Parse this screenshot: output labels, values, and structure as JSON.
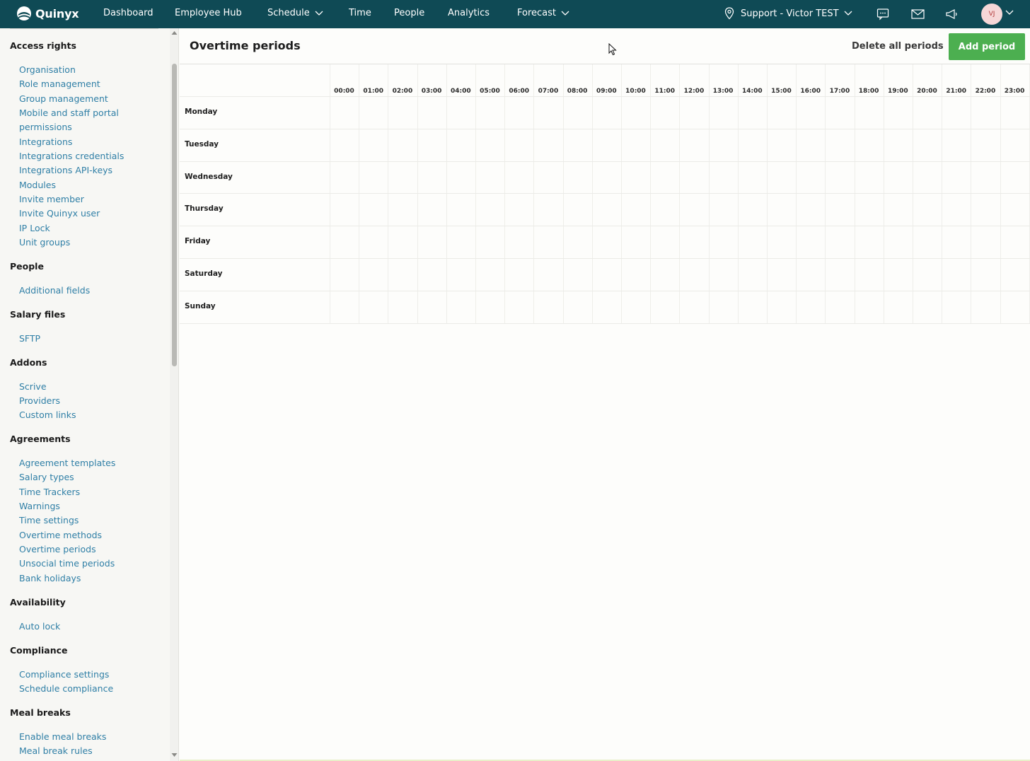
{
  "topnav": {
    "brand": "Quinyx",
    "items": [
      "Dashboard",
      "Employee Hub",
      "Schedule",
      "Time",
      "People",
      "Analytics",
      "Forecast"
    ],
    "location": "Support - Victor TEST",
    "avatar_initials": "VJ",
    "background": "#0f4a55"
  },
  "sidebar": {
    "sections": [
      {
        "title": "Access rights",
        "links": [
          "Organisation",
          "Role management",
          "Group management",
          "Mobile and staff portal",
          "permissions",
          "Integrations",
          "Integrations credentials",
          "Integrations API-keys",
          "Modules",
          "Invite member",
          "Invite Quinyx user",
          "IP Lock",
          "Unit groups"
        ]
      },
      {
        "title": "People",
        "links": [
          "Additional fields"
        ]
      },
      {
        "title": "Salary files",
        "links": [
          "SFTP"
        ]
      },
      {
        "title": "Addons",
        "links": [
          "Scrive",
          "Providers",
          "Custom links"
        ]
      },
      {
        "title": "Agreements",
        "links": [
          "Agreement templates",
          "Salary types",
          "Time Trackers",
          "Warnings",
          "Time settings",
          "Overtime methods",
          "Overtime periods",
          "Unsocial time periods",
          "Bank holidays"
        ]
      },
      {
        "title": "Availability",
        "links": [
          "Auto lock"
        ]
      },
      {
        "title": "Compliance",
        "links": [
          "Compliance settings",
          "Schedule compliance"
        ]
      },
      {
        "title": "Meal breaks",
        "links": [
          "Enable meal breaks",
          "Meal break rules"
        ]
      }
    ],
    "link_color": "#2f7fa6"
  },
  "main": {
    "title": "Overtime periods",
    "delete_label": "Delete all periods",
    "add_label": "Add period",
    "add_color": "#4caf50",
    "hours": [
      "00:00",
      "01:00",
      "02:00",
      "03:00",
      "04:00",
      "05:00",
      "06:00",
      "07:00",
      "08:00",
      "09:00",
      "10:00",
      "11:00",
      "12:00",
      "13:00",
      "14:00",
      "15:00",
      "16:00",
      "17:00",
      "18:00",
      "19:00",
      "20:00",
      "21:00",
      "22:00",
      "23:00"
    ],
    "days": [
      "Monday",
      "Tuesday",
      "Wednesday",
      "Thursday",
      "Friday",
      "Saturday",
      "Sunday"
    ]
  }
}
